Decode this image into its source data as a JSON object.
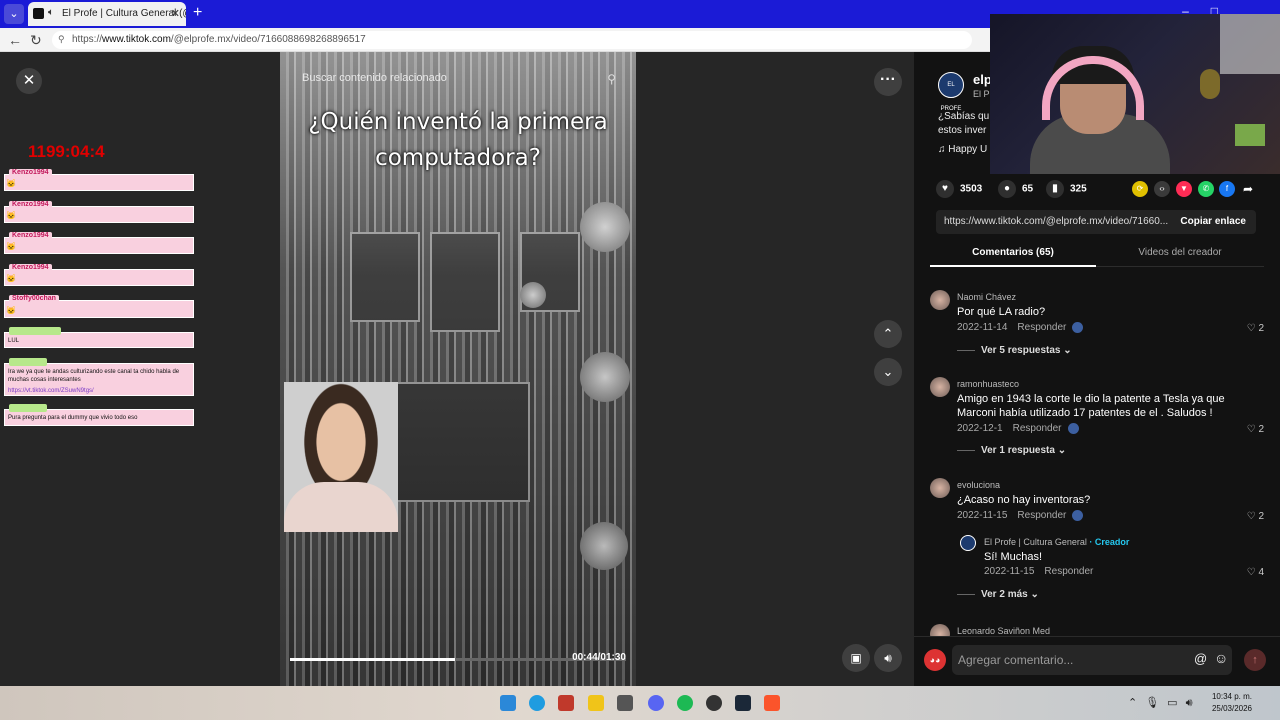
{
  "browser": {
    "tab_title": "El Profe | Cultura General (@e",
    "url_prefix": "https://",
    "url_host": "www.tiktok.com",
    "url_path": "/@elprofe.mx/video/7166088698268896517"
  },
  "overlay": {
    "timer": "1199:04:4",
    "chat": [
      {
        "user": "Kenzo1994",
        "emote": "🐱",
        "text": ""
      },
      {
        "user": "Kenzo1994",
        "emote": "🐱",
        "text": ""
      },
      {
        "user": "Kenzo1994",
        "emote": "🐱",
        "text": ""
      },
      {
        "user": "Kenzo1994",
        "emote": "🐱",
        "text": ""
      },
      {
        "user": "Stoffy00chan",
        "emote": "🐱",
        "text": ""
      },
      {
        "user": "",
        "emote": "",
        "text": "LUL"
      },
      {
        "user": "",
        "emote": "",
        "text": "Ira we ya que te andas culturizando este canal ta chido habla de muchas cosas interesantes",
        "link": "https://vt.tiktok.com/ZSuwN9tgs/"
      },
      {
        "user": "",
        "emote": "",
        "text": "Pura pregunta para el dummy que vivio todo eso"
      }
    ]
  },
  "video": {
    "search_placeholder": "Buscar contenido relacionado",
    "title": "¿Quién inventó la primera computadora?",
    "timecode": "00:44/01:30",
    "progress": 0.49
  },
  "creator": {
    "name": "elp",
    "sub": "El Pr",
    "avatar_text": "EL PROFE",
    "description": "¿Sabías qu estos inver",
    "music": "♫  Happy U"
  },
  "stats": {
    "likes": "3503",
    "comments": "65",
    "saves": "325"
  },
  "link": {
    "url": "https://www.tiktok.com/@elprofe.mx/video/71660...",
    "copy_label": "Copiar enlace"
  },
  "tabs": {
    "comments": "Comentarios (65)",
    "videos": "Videos del creador"
  },
  "comments": [
    {
      "user": "Naomi Chávez",
      "text": "Por qué LA radio?",
      "date": "2022-11-14",
      "reply": "Responder",
      "likes": "2",
      "more": "Ver 5 respuestas ⌄"
    },
    {
      "user": "ramonhuasteco",
      "text": "Amigo en 1943 la corte le dio la patente a Tesla ya que Marconi había utilizado 17 patentes de el . Saludos !",
      "date": "2022-12-1",
      "reply": "Responder",
      "likes": "2",
      "more": "Ver 1 respuesta ⌄"
    },
    {
      "user": "evoluciona",
      "text": "¿Acaso no hay inventoras?",
      "date": "2022-11-15",
      "reply": "Responder",
      "likes": "2",
      "more": "Ver 2 más ⌄"
    },
    {
      "user": "Leonardo Saviñon Med",
      "text": "",
      "date": "",
      "reply": "",
      "likes": "",
      "more": ""
    }
  ],
  "creator_reply": {
    "user": "El Profe | Cultura General",
    "tag": "· Creador",
    "text": "Sí! Muchas!",
    "date": "2022-11-15",
    "reply": "Responder",
    "likes": "4"
  },
  "comment_bar": {
    "placeholder": "Agregar comentario...",
    "at": "@"
  },
  "taskbar": {
    "time": "10:34 p. m.",
    "date": "25/03/2026"
  }
}
